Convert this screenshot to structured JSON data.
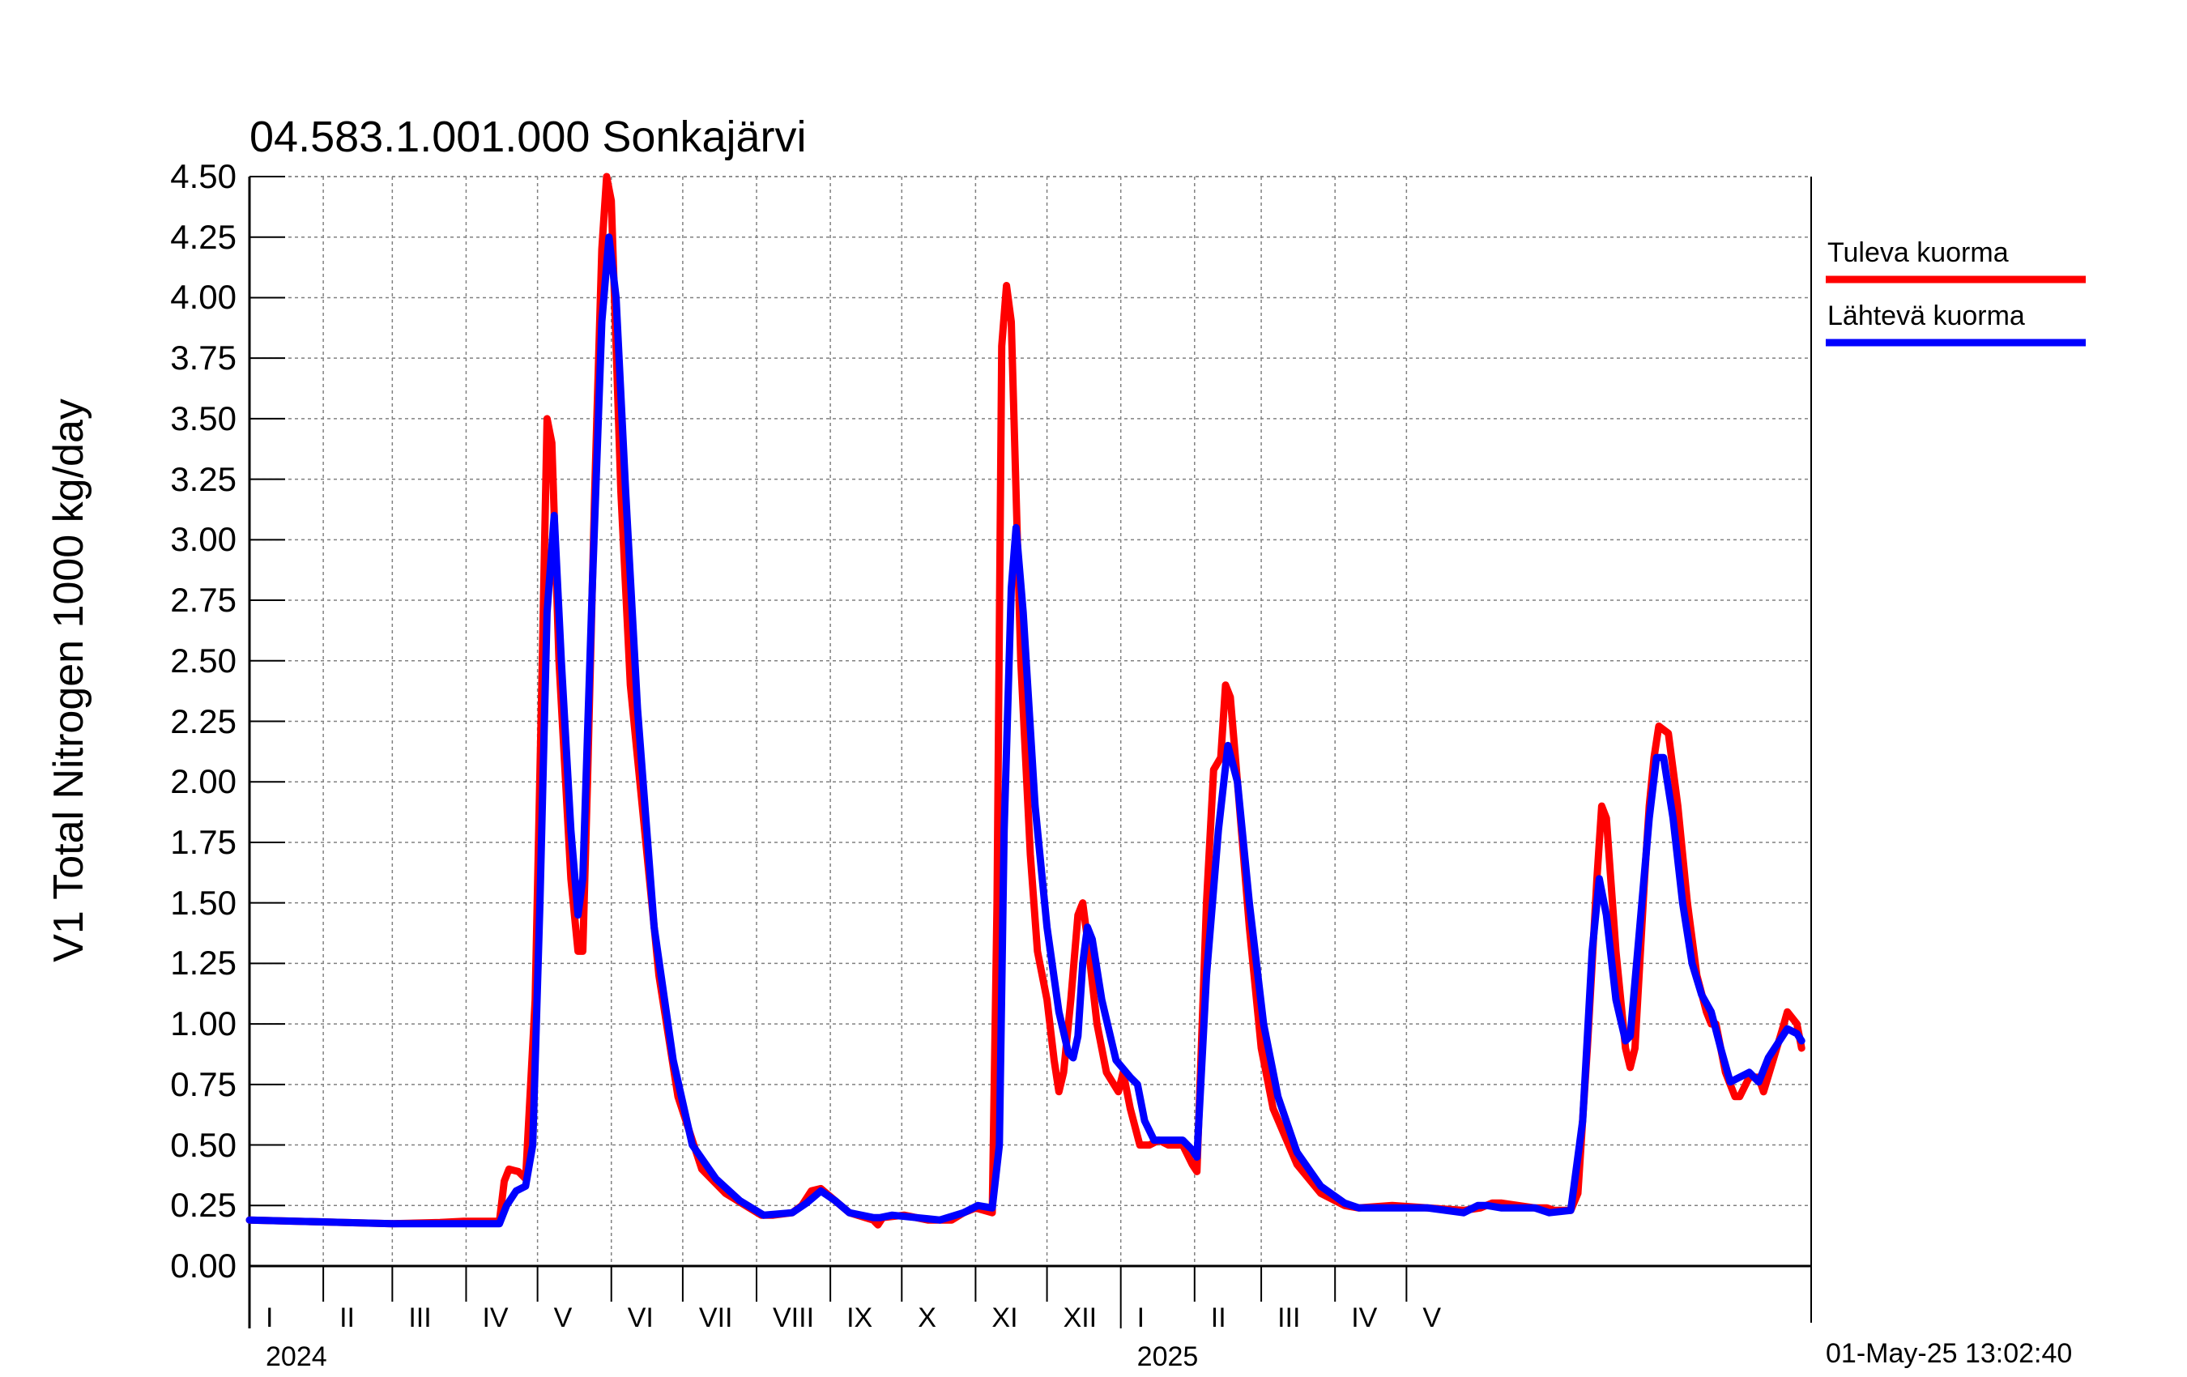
{
  "chart_data": {
    "type": "line",
    "title": "04.583.1.001.000 Sonkajärvi",
    "ylabel": "V1 Total Nitrogen 1000 kg/day",
    "ylim": [
      0,
      4.5
    ],
    "yticks": [
      "0.00",
      "0.25",
      "0.50",
      "0.75",
      "1.00",
      "1.25",
      "1.50",
      "1.75",
      "2.00",
      "2.25",
      "2.50",
      "2.75",
      "3.00",
      "3.25",
      "3.50",
      "3.75",
      "4.00",
      "4.25",
      "4.50"
    ],
    "months": [
      "I",
      "II",
      "III",
      "IV",
      "V",
      "VI",
      "VII",
      "VIII",
      "IX",
      "X",
      "XI",
      "XII",
      "I",
      "II",
      "III",
      "IV",
      "V"
    ],
    "years": [
      "2024",
      "2025"
    ],
    "timestamp": "01-May-25 13:02:40",
    "grid": true,
    "legend_position": "right",
    "x_unit": "days since 2024-01-01",
    "series": [
      {
        "name": "Tuleva kuorma",
        "color": "#ff0000",
        "points": [
          [
            0,
            0.19
          ],
          [
            20,
            0.185
          ],
          [
            40,
            0.18
          ],
          [
            60,
            0.175
          ],
          [
            80,
            0.18
          ],
          [
            90,
            0.185
          ],
          [
            105,
            0.185
          ],
          [
            107,
            0.35
          ],
          [
            109,
            0.4
          ],
          [
            113,
            0.39
          ],
          [
            116,
            0.36
          ],
          [
            120,
            1.1
          ],
          [
            123,
            2.5
          ],
          [
            125,
            3.5
          ],
          [
            127,
            3.4
          ],
          [
            130,
            2.5
          ],
          [
            135,
            1.6
          ],
          [
            138,
            1.3
          ],
          [
            140,
            1.3
          ],
          [
            142,
            2.0
          ],
          [
            145,
            3.2
          ],
          [
            148,
            4.2
          ],
          [
            150,
            4.5
          ],
          [
            152,
            4.4
          ],
          [
            156,
            3.2
          ],
          [
            160,
            2.4
          ],
          [
            165,
            1.9
          ],
          [
            172,
            1.2
          ],
          [
            180,
            0.7
          ],
          [
            190,
            0.4
          ],
          [
            200,
            0.3
          ],
          [
            210,
            0.24
          ],
          [
            215,
            0.21
          ],
          [
            220,
            0.21
          ],
          [
            228,
            0.22
          ],
          [
            232,
            0.25
          ],
          [
            236,
            0.31
          ],
          [
            240,
            0.32
          ],
          [
            246,
            0.27
          ],
          [
            252,
            0.22
          ],
          [
            262,
            0.19
          ],
          [
            264,
            0.17
          ],
          [
            266,
            0.2
          ],
          [
            275,
            0.21
          ],
          [
            285,
            0.19
          ],
          [
            295,
            0.19
          ],
          [
            300,
            0.22
          ],
          [
            305,
            0.24
          ],
          [
            312,
            0.22
          ],
          [
            314,
            1.5
          ],
          [
            316,
            3.8
          ],
          [
            318,
            4.05
          ],
          [
            320,
            3.9
          ],
          [
            324,
            2.5
          ],
          [
            328,
            1.7
          ],
          [
            331,
            1.3
          ],
          [
            335,
            1.1
          ],
          [
            338,
            0.85
          ],
          [
            340,
            0.72
          ],
          [
            342,
            0.8
          ],
          [
            345,
            1.1
          ],
          [
            348,
            1.45
          ],
          [
            350,
            1.5
          ],
          [
            352,
            1.35
          ],
          [
            356,
            1.0
          ],
          [
            360,
            0.8
          ],
          [
            365,
            0.72
          ],
          [
            367,
            0.8
          ],
          [
            370,
            0.65
          ],
          [
            374,
            0.5
          ],
          [
            378,
            0.5
          ],
          [
            382,
            0.52
          ],
          [
            386,
            0.5
          ],
          [
            392,
            0.5
          ],
          [
            396,
            0.42
          ],
          [
            398,
            0.39
          ],
          [
            402,
            1.5
          ],
          [
            405,
            2.05
          ],
          [
            408,
            2.1
          ],
          [
            410,
            2.4
          ],
          [
            412,
            2.35
          ],
          [
            415,
            2.0
          ],
          [
            420,
            1.4
          ],
          [
            425,
            0.9
          ],
          [
            430,
            0.65
          ],
          [
            440,
            0.42
          ],
          [
            450,
            0.3
          ],
          [
            460,
            0.25
          ],
          [
            466,
            0.24
          ],
          [
            480,
            0.25
          ],
          [
            495,
            0.24
          ],
          [
            510,
            0.23
          ],
          [
            517,
            0.24
          ],
          [
            522,
            0.26
          ],
          [
            526,
            0.26
          ],
          [
            540,
            0.24
          ],
          [
            545,
            0.24
          ],
          [
            548,
            0.23
          ],
          [
            555,
            0.23
          ],
          [
            558,
            0.3
          ],
          [
            562,
            0.9
          ],
          [
            566,
            1.6
          ],
          [
            568,
            1.9
          ],
          [
            570,
            1.85
          ],
          [
            574,
            1.3
          ],
          [
            578,
            0.9
          ],
          [
            580,
            0.82
          ],
          [
            582,
            0.9
          ],
          [
            586,
            1.6
          ],
          [
            588,
            1.9
          ],
          [
            590,
            2.1
          ],
          [
            592,
            2.23
          ],
          [
            596,
            2.2
          ],
          [
            600,
            1.9
          ],
          [
            604,
            1.5
          ],
          [
            608,
            1.2
          ],
          [
            612,
            1.05
          ],
          [
            614,
            1.0
          ],
          [
            616,
            1.0
          ],
          [
            620,
            0.8
          ],
          [
            624,
            0.7
          ],
          [
            626,
            0.7
          ],
          [
            630,
            0.78
          ],
          [
            634,
            0.78
          ],
          [
            636,
            0.72
          ],
          [
            640,
            0.85
          ],
          [
            644,
            0.98
          ],
          [
            646,
            1.05
          ],
          [
            650,
            1.0
          ],
          [
            652,
            0.9
          ]
        ]
      },
      {
        "name": "Lähtevä kuorma",
        "color": "#0000ff",
        "points": [
          [
            0,
            0.19
          ],
          [
            20,
            0.185
          ],
          [
            40,
            0.18
          ],
          [
            60,
            0.175
          ],
          [
            80,
            0.175
          ],
          [
            90,
            0.175
          ],
          [
            105,
            0.175
          ],
          [
            108,
            0.25
          ],
          [
            112,
            0.31
          ],
          [
            116,
            0.33
          ],
          [
            119,
            0.5
          ],
          [
            122,
            1.5
          ],
          [
            125,
            2.7
          ],
          [
            128,
            3.1
          ],
          [
            131,
            2.5
          ],
          [
            135,
            1.8
          ],
          [
            138,
            1.45
          ],
          [
            140,
            1.6
          ],
          [
            144,
            2.8
          ],
          [
            148,
            3.9
          ],
          [
            151,
            4.25
          ],
          [
            154,
            4.0
          ],
          [
            158,
            3.2
          ],
          [
            163,
            2.3
          ],
          [
            170,
            1.4
          ],
          [
            178,
            0.85
          ],
          [
            186,
            0.5
          ],
          [
            196,
            0.36
          ],
          [
            206,
            0.27
          ],
          [
            216,
            0.21
          ],
          [
            228,
            0.22
          ],
          [
            234,
            0.26
          ],
          [
            240,
            0.31
          ],
          [
            246,
            0.27
          ],
          [
            252,
            0.22
          ],
          [
            262,
            0.2
          ],
          [
            265,
            0.2
          ],
          [
            270,
            0.21
          ],
          [
            280,
            0.2
          ],
          [
            290,
            0.19
          ],
          [
            300,
            0.22
          ],
          [
            306,
            0.25
          ],
          [
            312,
            0.24
          ],
          [
            315,
            0.5
          ],
          [
            317,
            1.8
          ],
          [
            320,
            2.8
          ],
          [
            322,
            3.05
          ],
          [
            325,
            2.7
          ],
          [
            330,
            1.9
          ],
          [
            335,
            1.4
          ],
          [
            340,
            1.05
          ],
          [
            344,
            0.88
          ],
          [
            346,
            0.86
          ],
          [
            348,
            0.95
          ],
          [
            350,
            1.25
          ],
          [
            352,
            1.4
          ],
          [
            354,
            1.35
          ],
          [
            358,
            1.1
          ],
          [
            364,
            0.85
          ],
          [
            370,
            0.78
          ],
          [
            373,
            0.75
          ],
          [
            376,
            0.6
          ],
          [
            380,
            0.52
          ],
          [
            386,
            0.52
          ],
          [
            392,
            0.52
          ],
          [
            396,
            0.48
          ],
          [
            398,
            0.45
          ],
          [
            402,
            1.2
          ],
          [
            407,
            1.8
          ],
          [
            411,
            2.15
          ],
          [
            415,
            2.0
          ],
          [
            420,
            1.5
          ],
          [
            426,
            1.0
          ],
          [
            432,
            0.7
          ],
          [
            440,
            0.47
          ],
          [
            450,
            0.33
          ],
          [
            460,
            0.26
          ],
          [
            466,
            0.24
          ],
          [
            480,
            0.24
          ],
          [
            495,
            0.24
          ],
          [
            510,
            0.22
          ],
          [
            516,
            0.25
          ],
          [
            520,
            0.25
          ],
          [
            526,
            0.24
          ],
          [
            540,
            0.24
          ],
          [
            546,
            0.22
          ],
          [
            555,
            0.23
          ],
          [
            560,
            0.6
          ],
          [
            564,
            1.3
          ],
          [
            567,
            1.6
          ],
          [
            570,
            1.45
          ],
          [
            574,
            1.1
          ],
          [
            578,
            0.93
          ],
          [
            580,
            0.95
          ],
          [
            584,
            1.4
          ],
          [
            588,
            1.85
          ],
          [
            591,
            2.1
          ],
          [
            594,
            2.1
          ],
          [
            598,
            1.85
          ],
          [
            602,
            1.5
          ],
          [
            606,
            1.25
          ],
          [
            610,
            1.12
          ],
          [
            614,
            1.05
          ],
          [
            618,
            0.9
          ],
          [
            622,
            0.76
          ],
          [
            626,
            0.78
          ],
          [
            630,
            0.8
          ],
          [
            634,
            0.76
          ],
          [
            638,
            0.86
          ],
          [
            642,
            0.92
          ],
          [
            646,
            0.98
          ],
          [
            650,
            0.96
          ],
          [
            652,
            0.93
          ]
        ]
      }
    ]
  }
}
